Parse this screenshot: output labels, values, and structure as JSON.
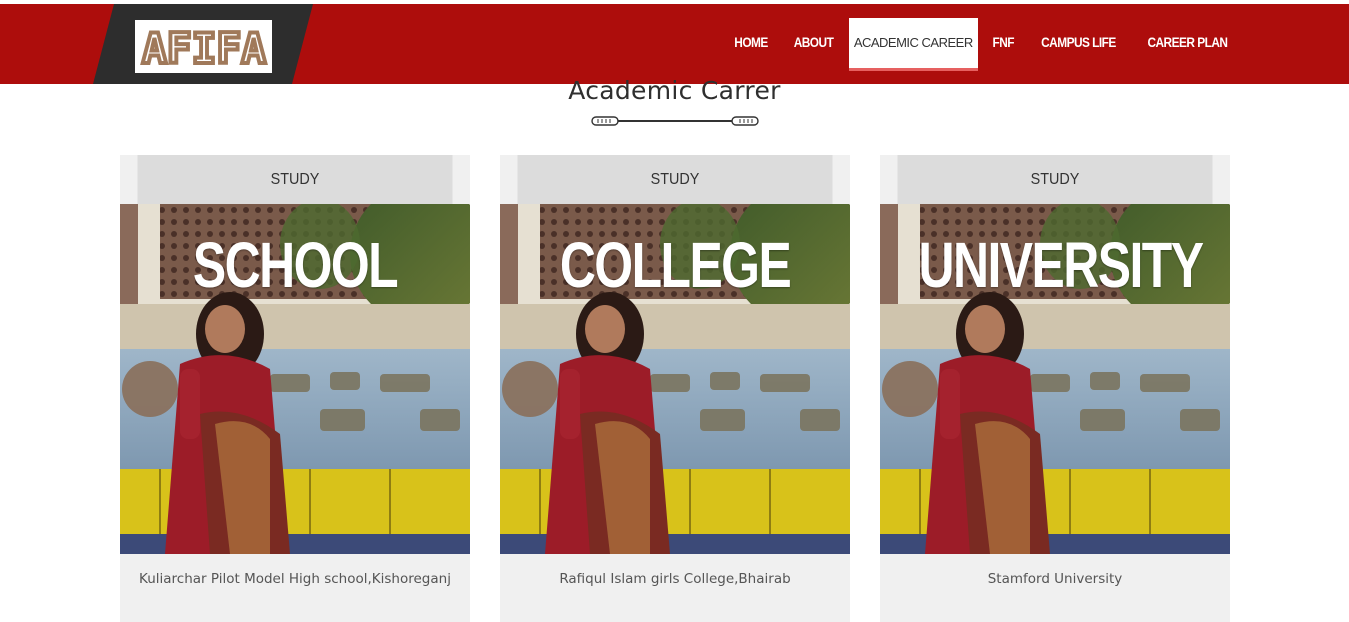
{
  "brand": {
    "logo_text": "AFIFA",
    "header_color": "#ad0d0c",
    "logo_plate_color": "#2d2d2d",
    "logo_text_color": "#a0795a"
  },
  "nav": {
    "items": [
      {
        "label": "HOME",
        "active": false
      },
      {
        "label": "ABOUT",
        "active": false
      },
      {
        "label": "ACADEMIC CAREER",
        "active": true
      },
      {
        "label": "FNF",
        "active": false
      },
      {
        "label": "CAMPUS LIFE",
        "active": false
      },
      {
        "label": "CAREER PLAN",
        "active": false
      }
    ]
  },
  "section": {
    "title": "Academic Carrer",
    "divider_icon": "cable-divider-icon"
  },
  "cards": [
    {
      "header": "STUDY",
      "photo_title": "SCHOOL",
      "caption": "Kuliarchar Pilot Model High school,Kishoreganj"
    },
    {
      "header": "STUDY",
      "photo_title": "COLLEGE",
      "caption": "Rafiqul Islam girls College,Bhairab"
    },
    {
      "header": "STUDY",
      "photo_title": "UNIVERSITY",
      "caption": "Stamford University"
    }
  ]
}
